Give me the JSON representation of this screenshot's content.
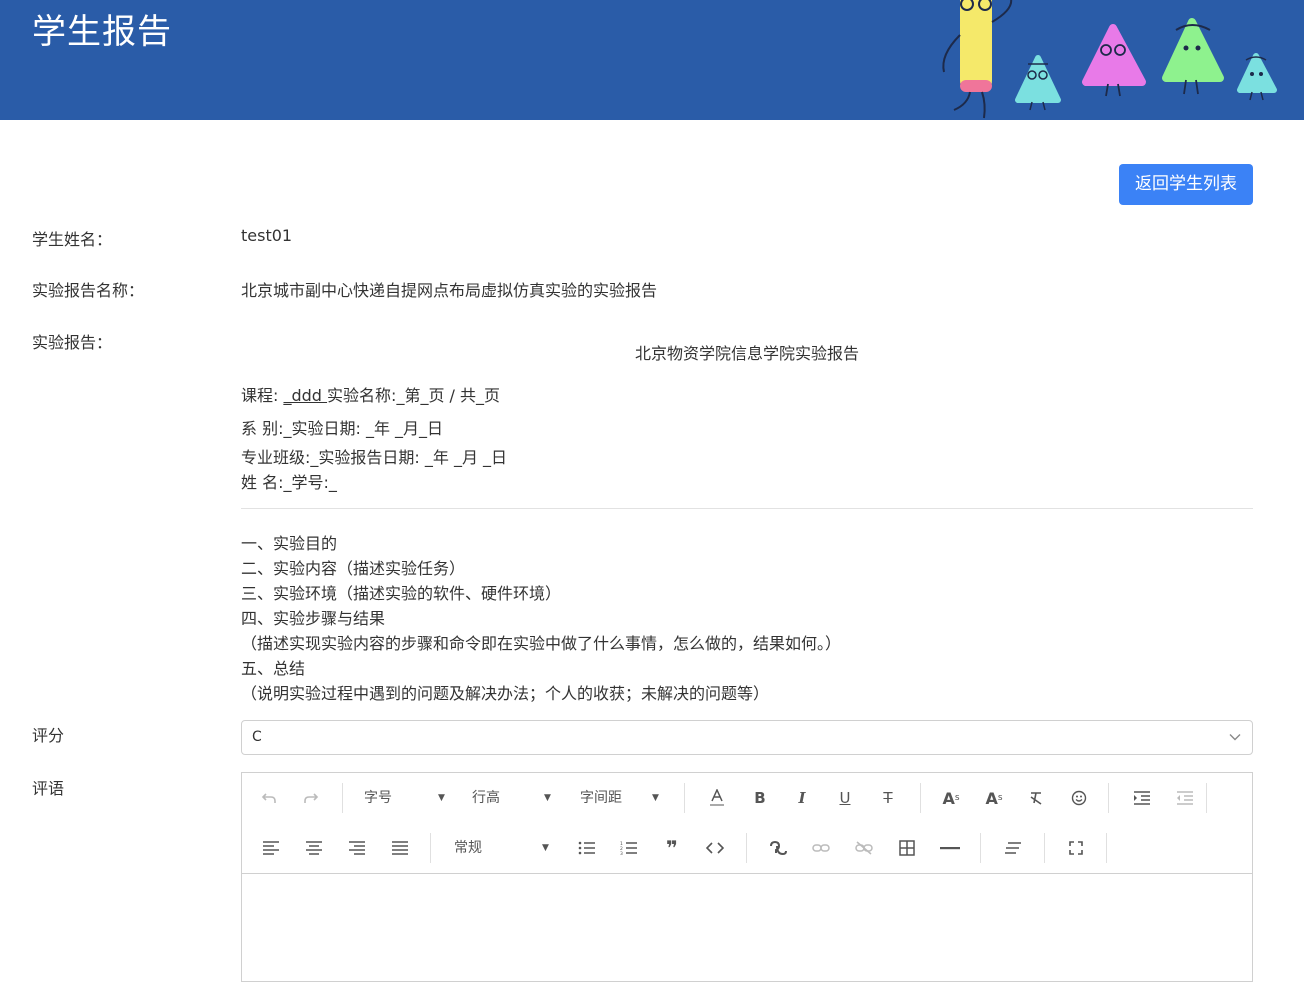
{
  "header": {
    "title": "学生报告"
  },
  "actions": {
    "back_label": "返回学生列表"
  },
  "fields": {
    "student_name_label": "学生姓名：",
    "student_name_value": "test01",
    "report_name_label": "实验报告名称：",
    "report_name_value": "北京城市副中心快递自提网点布局虚拟仿真实验的实验报告",
    "report_label": "实验报告："
  },
  "report": {
    "title": "北京物资学院信息学院实验报告",
    "course_prefix": "课程: ",
    "course_value": "_ddd ",
    "course_rest": "实验名称:_第_页 / 共_页",
    "dept_line": "系 别:_实验日期: _年 _月_日",
    "class_line": "专业班级:_实验报告日期: _年 _月 _日",
    "name_line": "姓 名:_学号:_",
    "sections": [
      "一、实验目的",
      "二、实验内容（描述实验任务）",
      "三、实验环境（描述实验的软件、硬件环境）",
      "四、实验步骤与结果",
      "（描述实现实验内容的步骤和命令即在实验中做了什么事情，怎么做的，结果如何。）",
      "五、总结",
      "（说明实验过程中遇到的问题及解决办法；个人的收获；未解决的问题等）"
    ]
  },
  "grade": {
    "label": "评分",
    "selected": "C"
  },
  "comment": {
    "label": "评语",
    "content": ""
  },
  "toolbar": {
    "font_size": "字号",
    "line_height": "行高",
    "letter_spacing": "字间距",
    "paragraph_format": "常规",
    "icons": [
      "undo-icon",
      "redo-icon",
      "font-color-icon",
      "bold-icon",
      "italic-icon",
      "underline-icon",
      "strikethrough-icon",
      "superscript-icon",
      "subscript-icon",
      "clear-format-icon",
      "emoji-icon",
      "indent-icon",
      "outdent-icon",
      "align-left-icon",
      "align-center-icon",
      "align-right-icon",
      "align-justify-icon",
      "bullet-list-icon",
      "numbered-list-icon",
      "blockquote-icon",
      "code-icon",
      "link-icon",
      "link-disabled-icon",
      "unlink-icon",
      "table-icon",
      "horizontal-rule-icon",
      "clear-icon",
      "fullscreen-icon"
    ]
  },
  "colors": {
    "header_bg": "#2a5ca8",
    "primary_button": "#3b82f6"
  }
}
